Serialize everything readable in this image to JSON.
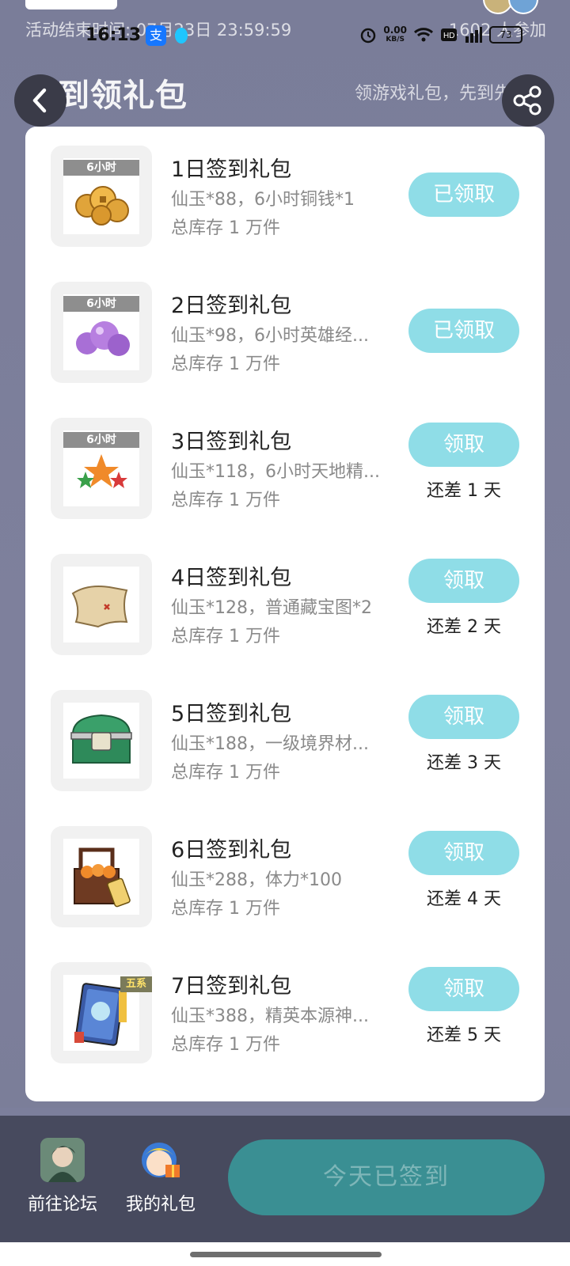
{
  "header": {
    "activity_end": "活动结束时间: 07月23日 23:59:59",
    "participants": "1602 人参加",
    "title": "签到领礼包",
    "subtitle": "领游戏礼包，先到先得"
  },
  "status_bar": {
    "time": "16:13",
    "net_speed_value": "0.00",
    "net_speed_unit": "KB/S",
    "battery": "73",
    "icons": [
      "alarm-icon",
      "wifi-icon",
      "hd-icon",
      "signal-icon",
      "battery-icon"
    ]
  },
  "gifts": [
    {
      "title": "1日签到礼包",
      "desc": "仙玉*88，6小时铜钱*1",
      "stock": "总库存 1 万件",
      "tag": "6小时",
      "button": "已领取",
      "days_left": ""
    },
    {
      "title": "2日签到礼包",
      "desc": "仙玉*98，6小时英雄经...",
      "stock": "总库存 1 万件",
      "tag": "6小时",
      "button": "已领取",
      "days_left": ""
    },
    {
      "title": "3日签到礼包",
      "desc": "仙玉*118，6小时天地精...",
      "stock": "总库存 1 万件",
      "tag": "6小时",
      "button": "领取",
      "days_left": "还差 1 天"
    },
    {
      "title": "4日签到礼包",
      "desc": "仙玉*128，普通藏宝图*2",
      "stock": "总库存 1 万件",
      "tag": "",
      "button": "领取",
      "days_left": "还差 2 天"
    },
    {
      "title": "5日签到礼包",
      "desc": "仙玉*188，一级境界材...",
      "stock": "总库存 1 万件",
      "tag": "",
      "button": "领取",
      "days_left": "还差 3 天"
    },
    {
      "title": "6日签到礼包",
      "desc": "仙玉*288，体力*100",
      "stock": "总库存 1 万件",
      "tag": "",
      "button": "领取",
      "days_left": "还差 4 天"
    },
    {
      "title": "7日签到礼包",
      "desc": "仙玉*388，精英本源神...",
      "stock": "总库存 1 万件",
      "tag": "五系",
      "button": "领取",
      "days_left": "还差 5 天"
    }
  ],
  "bottom": {
    "forum_label": "前往论坛",
    "my_gifts_label": "我的礼包",
    "checkin_label": "今天已签到"
  },
  "colors": {
    "background": "#7c7f9c",
    "claim_button": "#8fdde7",
    "checkin_button": "#3a8f93",
    "bottom_bar": "#474a5e"
  }
}
